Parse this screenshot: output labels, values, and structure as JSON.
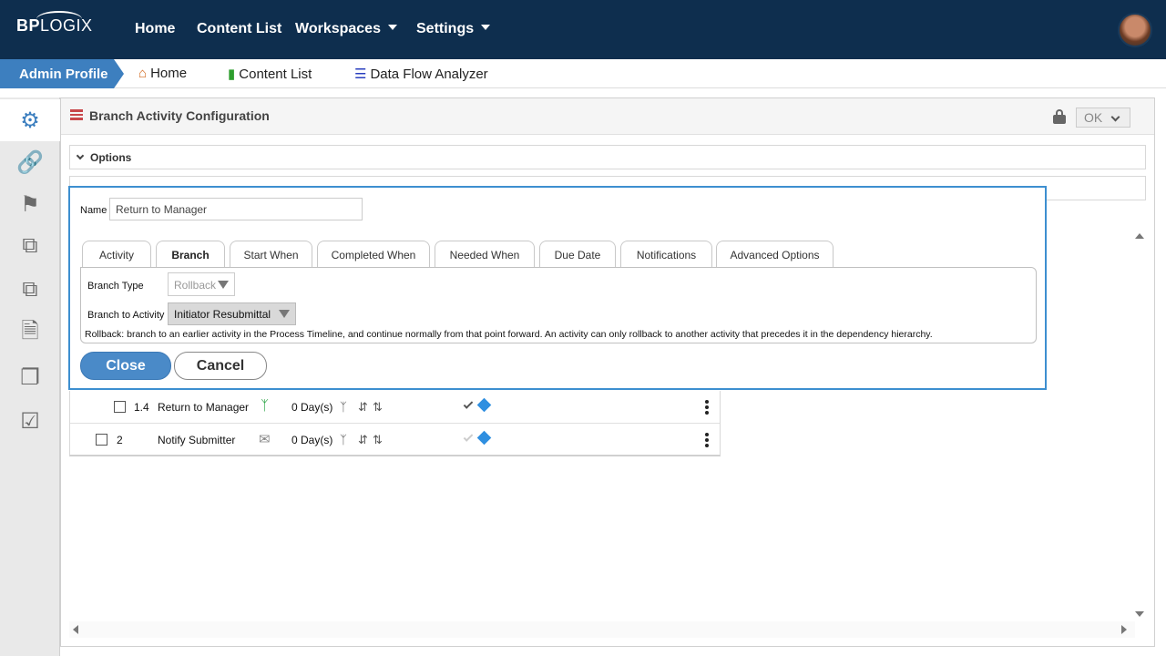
{
  "topnav": {
    "logo_bp": "BP",
    "logo_logix": "LOGIX",
    "items": [
      {
        "label": "Home"
      },
      {
        "label": "Content List"
      },
      {
        "label": "Workspaces"
      },
      {
        "label": "Settings"
      }
    ]
  },
  "breadcrumb": {
    "admin": "Admin Profile",
    "items": [
      {
        "label": "Home",
        "icon": "home-icon"
      },
      {
        "label": "Content List",
        "icon": "folder-icon"
      },
      {
        "label": "Data Flow Analyzer",
        "icon": "database-icon"
      }
    ]
  },
  "sidebar": {
    "items": [
      "gear-icon",
      "link-icon",
      "flag-icon",
      "subform-icon",
      "copy-icon",
      "locked-document-icon",
      "documents-icon",
      "checked-document-icon"
    ]
  },
  "panel": {
    "title": "Branch Activity Configuration",
    "ok_label": "OK",
    "options_label": "Options"
  },
  "table": {
    "rows": [
      {
        "num": "1.4",
        "name": "Return to Manager",
        "days": "0 Day(s)",
        "type_icon": "branch-icon",
        "check_state": "dark"
      },
      {
        "num": "2",
        "name": "Notify Submitter",
        "days": "0 Day(s)",
        "type_icon": "envelope-icon",
        "check_state": "light"
      }
    ]
  },
  "dialog": {
    "name_label": "Name",
    "name_value": "Return to Manager",
    "tabs": [
      {
        "label": "Activity"
      },
      {
        "label": "Branch",
        "active": true
      },
      {
        "label": "Start When"
      },
      {
        "label": "Completed When"
      },
      {
        "label": "Needed When"
      },
      {
        "label": "Due Date"
      },
      {
        "label": "Notifications"
      },
      {
        "label": "Advanced Options"
      }
    ],
    "branch_type_label": "Branch Type",
    "branch_type_value": "Rollback",
    "branch_to_label": "Branch to Activity",
    "branch_to_value": "Initiator Resubmittal",
    "help_text": "Rollback: branch to an earlier activity in the Process Timeline, and continue normally from that point forward. An activity can only rollback to another activity that precedes it in the dependency hierarchy.",
    "close_label": "Close",
    "cancel_label": "Cancel"
  },
  "colors": {
    "nav_bg": "#0e2e4e",
    "accent": "#3d7fbf",
    "dialog_border": "#3d8fd0",
    "milestone": "#2f8fe0"
  }
}
